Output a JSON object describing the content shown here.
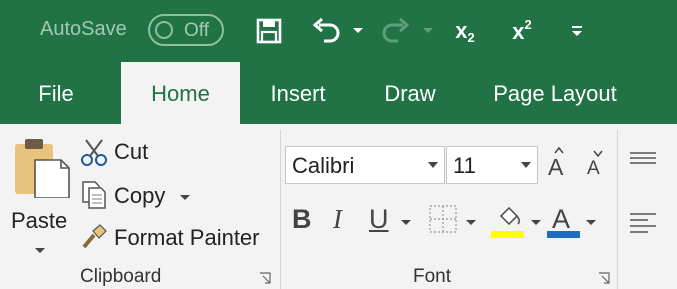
{
  "qat": {
    "autosave_label": "AutoSave",
    "toggle_state": "Off",
    "subscript_base": "x",
    "subscript_sub": "2",
    "superscript_base": "x",
    "superscript_sup": "2"
  },
  "tabs": [
    {
      "label": "File",
      "active": false
    },
    {
      "label": "Home",
      "active": true
    },
    {
      "label": "Insert",
      "active": false
    },
    {
      "label": "Draw",
      "active": false
    },
    {
      "label": "Page Layout",
      "active": false
    }
  ],
  "clipboard": {
    "paste_label": "Paste",
    "cut_label": "Cut",
    "copy_label": "Copy",
    "format_painter_label": "Format Painter",
    "group_label": "Clipboard"
  },
  "font": {
    "font_name": "Calibri",
    "font_size": "11",
    "bold_label": "B",
    "italic_label": "I",
    "underline_label": "U",
    "increase_size_label": "A",
    "decrease_size_label": "A",
    "font_color_label": "A",
    "group_label": "Font"
  },
  "colors": {
    "brand": "#217346",
    "highlight": "#ffff00",
    "font_color": "#1e6dc1"
  }
}
